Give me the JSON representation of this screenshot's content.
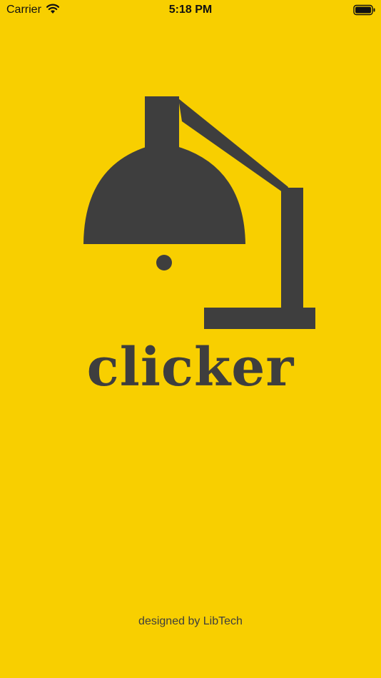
{
  "status_bar": {
    "carrier": "Carrier",
    "time": "5:18 PM"
  },
  "splash": {
    "app_name": "clicker",
    "credit": "designed by LibTech"
  },
  "colors": {
    "background": "#F8CF00",
    "logo": "#3E3E3E"
  },
  "icons": [
    "wifi-icon",
    "battery-icon",
    "desk-lamp-icon"
  ]
}
